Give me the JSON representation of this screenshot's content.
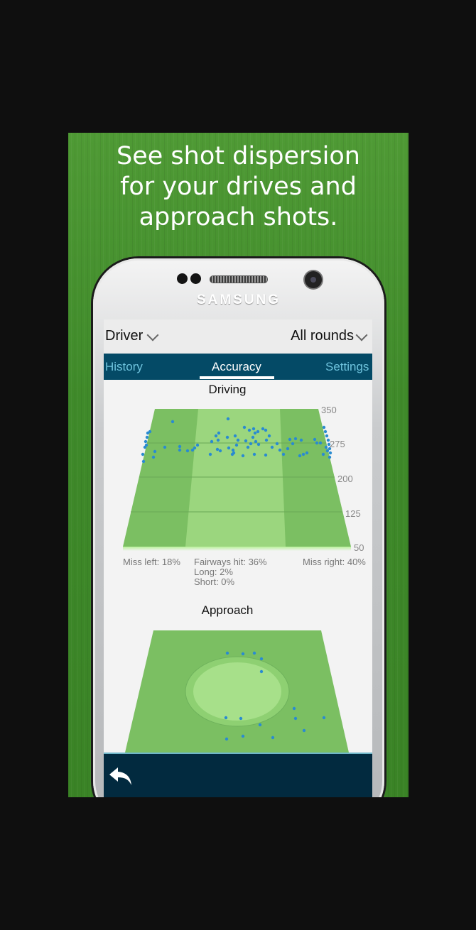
{
  "promo": {
    "headline_lines": [
      "See shot dispersion",
      "for your drives and",
      "approach shots."
    ]
  },
  "device": {
    "brand": "SAMSUNG"
  },
  "app": {
    "club_select": {
      "value": "Driver"
    },
    "rounds_select": {
      "value": "All rounds"
    },
    "tabs": [
      {
        "label": "History",
        "active": false
      },
      {
        "label": "Accuracy",
        "active": true
      },
      {
        "label": "Settings",
        "active": false
      }
    ],
    "driving": {
      "title": "Driving",
      "yard_labels": [
        "350",
        "275",
        "200",
        "125",
        "50"
      ],
      "miss_left": "Miss left: 18%",
      "fairways_hit": "Fairways hit: 36%",
      "long": "Long: 2%",
      "short": "Short: 0%",
      "miss_right": "Miss right: 40%"
    },
    "approach": {
      "title": "Approach"
    },
    "bottom_bar": {
      "back_icon": "back-arrow-icon"
    }
  },
  "colors": {
    "tab_bar": "#044a66",
    "bottom_bar": "#022a3f",
    "shot_dot": "#2a8bd0",
    "fairway": "#9bd67e",
    "rough": "#7bbf62"
  }
}
